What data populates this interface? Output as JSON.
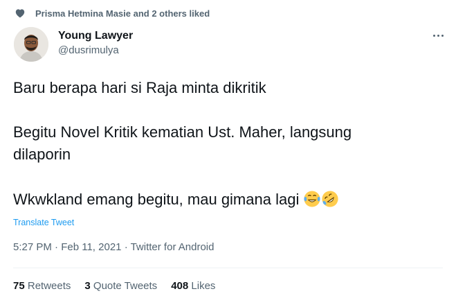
{
  "social_context": {
    "icon": "heart-icon",
    "text": "Prisma Hetmina Masie and 2 others liked"
  },
  "author": {
    "display_name": "Young Lawyer",
    "handle": "@dusrimulya"
  },
  "tweet": {
    "line1": "Baru berapa hari si Raja minta dikritik",
    "line2": "Begitu Novel Kritik kematian Ust. Maher, langsung",
    "line3": "dilaporin",
    "line4": "Wkwkland emang begitu, mau gimana lagi",
    "emojis": [
      "face-with-tears-of-joy",
      "rolling-on-the-floor-laughing"
    ]
  },
  "translate_label": "Translate Tweet",
  "meta": {
    "time": "5:27 PM",
    "date": "Feb 11, 2021",
    "source": "Twitter for Android",
    "separator": "·"
  },
  "stats": {
    "retweets_count": "75",
    "retweets_label": "Retweets",
    "quotes_count": "3",
    "quotes_label": "Quote Tweets",
    "likes_count": "408",
    "likes_label": "Likes"
  },
  "colors": {
    "primary_text": "#0f1419",
    "secondary_text": "#536471",
    "accent": "#1d9bf0",
    "divider": "#eff3f4"
  }
}
